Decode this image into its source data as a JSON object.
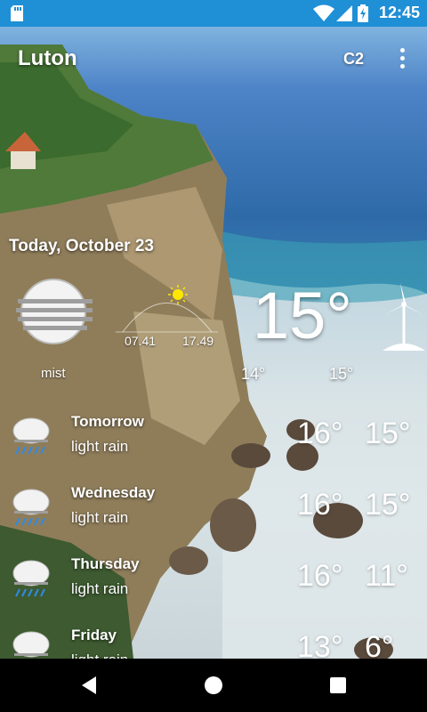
{
  "status": {
    "time": "12:45"
  },
  "app": {
    "title": "Luton",
    "unit_label": "C2"
  },
  "today": {
    "date": "Today, October 23",
    "condition": "mist",
    "sunrise": "07.41",
    "sunset": "17.49",
    "current_temp": "15°",
    "low": "14°",
    "high": "15°",
    "icon": "mist-icon"
  },
  "forecast": [
    {
      "day": "Tomorrow",
      "desc": "light rain",
      "high": "16°",
      "low": "15°",
      "icon": "rain-cloud-icon"
    },
    {
      "day": "Wednesday",
      "desc": "light rain",
      "high": "16°",
      "low": "15°",
      "icon": "rain-cloud-icon"
    },
    {
      "day": "Thursday",
      "desc": "light rain",
      "high": "16°",
      "low": "11°",
      "icon": "rain-cloud-icon"
    },
    {
      "day": "Friday",
      "desc": "light rain",
      "high": "13°",
      "low": "6°",
      "icon": "rain-cloud-icon"
    }
  ],
  "colors": {
    "status_bar": "#1f8fd6",
    "nav_bar": "#000000",
    "rain": "#2f8be6"
  }
}
